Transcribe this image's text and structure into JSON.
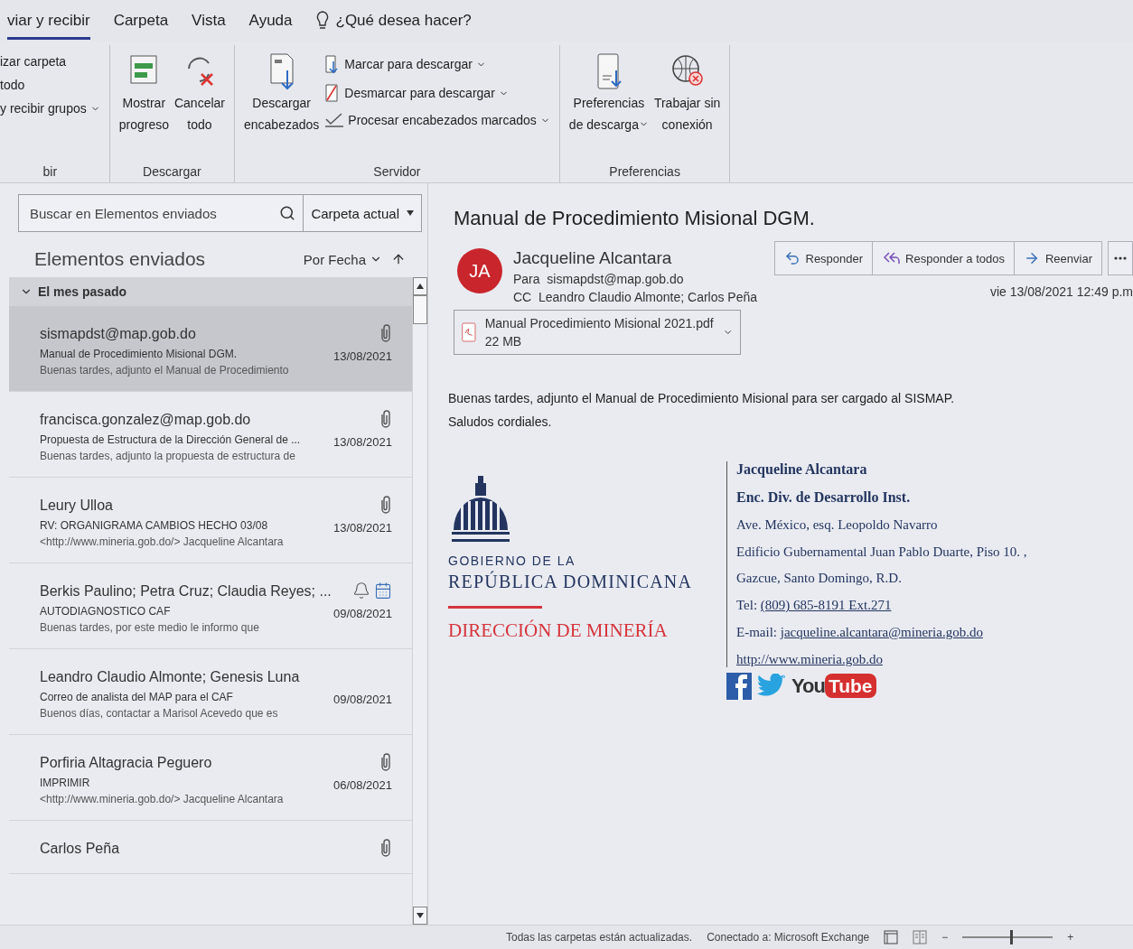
{
  "ribbon": {
    "tabs": [
      {
        "label": "viar y recibir",
        "selected": true
      },
      {
        "label": "Carpeta",
        "selected": false
      },
      {
        "label": "Vista",
        "selected": false
      },
      {
        "label": "Ayuda",
        "selected": false
      }
    ],
    "tell_me": "¿Qué desea hacer?",
    "groups": [
      {
        "label": "bir",
        "items": [
          {
            "kind": "small",
            "label": "izar carpeta",
            "dropdown": false
          },
          {
            "kind": "small",
            "label": "todo",
            "dropdown": false
          },
          {
            "kind": "small",
            "label": "y recibir grupos",
            "dropdown": true
          }
        ]
      },
      {
        "label": "Descargar",
        "items": [
          {
            "kind": "large",
            "lines": [
              "Mostrar",
              "progreso"
            ],
            "dropdown": false
          },
          {
            "kind": "large",
            "lines": [
              "Cancelar",
              "todo"
            ],
            "dropdown": false
          }
        ]
      },
      {
        "label": "Servidor",
        "items": [
          {
            "kind": "large",
            "lines": [
              "Descargar",
              "encabezados"
            ],
            "dropdown": false
          },
          {
            "kind": "small",
            "label": "Marcar para descargar",
            "dropdown": true
          },
          {
            "kind": "small",
            "label": "Desmarcar para descargar",
            "dropdown": true
          },
          {
            "kind": "small",
            "label": "Procesar encabezados marcados",
            "dropdown": true
          }
        ]
      },
      {
        "label": "Preferencias",
        "items": [
          {
            "kind": "large",
            "lines": [
              "Preferencias",
              "de descarga"
            ],
            "dropdown": true
          },
          {
            "kind": "large",
            "lines": [
              "Trabajar sin",
              "conexión"
            ],
            "dropdown": false
          }
        ]
      }
    ]
  },
  "mail_list": {
    "search": {
      "placeholder": "Buscar en Elementos enviados"
    },
    "scope": "Carpeta actual",
    "folder": "Elementos enviados",
    "sort": "Por Fecha",
    "group": "El mes pasado",
    "messages": [
      {
        "sender": "sismapdst@map.gob.do",
        "subject": "Manual de Procedimiento Misional DGM.",
        "preview": "Buenas tardes, adjunto el Manual de Procedimiento",
        "date": "13/08/2021",
        "kind": "attachment",
        "selected": true
      },
      {
        "sender": "francisca.gonzalez@map.gob.do",
        "subject": "Propuesta de Estructura de la Dirección General de ...",
        "preview": "Buenas tardes, adjunto la propuesta de estructura de",
        "date": "13/08/2021",
        "kind": "attachment",
        "selected": false
      },
      {
        "sender": "Leury Ulloa",
        "subject": "RV: ORGANIGRAMA CAMBIOS HECHO 03/08",
        "preview": "<http://www.mineria.gob.do/>  Jacqueline Alcantara",
        "date": "13/08/2021",
        "kind": "attachment",
        "selected": false
      },
      {
        "sender": "Berkis Paulino; Petra Cruz; Claudia Reyes; ...",
        "subject": "AUTODIAGNOSTICO CAF",
        "preview": "Buenas tardes, por este medio le informo que",
        "date": "09/08/2021",
        "kind": "meeting",
        "selected": false
      },
      {
        "sender": "Leandro Claudio Almonte; Genesis Luna",
        "subject": "Correo de analista del MAP para el CAF",
        "preview": "Buenos días,  contactar a Marisol Acevedo que es",
        "date": "09/08/2021",
        "kind": "plain",
        "selected": false
      },
      {
        "sender": "Porfiria Altagracia Peguero",
        "subject": "IMPRIMIR",
        "preview": "<http://www.mineria.gob.do/>  Jacqueline Alcantara",
        "date": "06/08/2021",
        "kind": "attachment",
        "selected": false
      },
      {
        "sender": "Carlos  Peña",
        "kind": "attachment",
        "selected": false
      }
    ]
  },
  "reading": {
    "title": "Manual de Procedimiento Misional DGM.",
    "initials": "JA",
    "from": "Jacqueline Alcantara",
    "to_label": "Para",
    "to": "sismapdst@map.gob.do",
    "cc_label": "CC",
    "cc": "Leandro Claudio Almonte; Carlos  Peña",
    "date": "vie 13/08/2021 12:49 p.m",
    "actions": [
      "Responder",
      "Responder a todos",
      "Reenviar"
    ],
    "attachment": {
      "name": "Manual Procedimiento Misional 2021.pdf",
      "size": "22 MB"
    },
    "body": [
      "Buenas tardes, adjunto el Manual de Procedimiento Misional para ser cargado al SISMAP.",
      "Saludos cordiales."
    ],
    "signature": {
      "logo": {
        "line1": "GOBIERNO DE LA",
        "line2": "REPÚBLICA DOMINICANA",
        "line3": "DIRECCIÓN DE MINERÍA"
      },
      "lines": [
        {
          "kind": "bold",
          "text": "Jacqueline Alcantara"
        },
        {
          "kind": "bold",
          "text": "Enc. Div. de Desarrollo   Inst."
        },
        {
          "kind": "plain",
          "text": "Ave. México, esq. Leopoldo Navarro"
        },
        {
          "kind": "plain",
          "text": "Edificio Gubernamental Juan Pablo Duarte, Piso 10. ,"
        },
        {
          "kind": "plain",
          "text": "Gazcue, Santo Domingo, R.D."
        },
        {
          "kind": "link",
          "label": "Tel:",
          "text": "(809) 685-8191 Ext.271"
        },
        {
          "kind": "link",
          "label": "E-mail:",
          "text": "jacqueline.alcantara@mineria.gob.do"
        },
        {
          "kind": "link",
          "text": "http://www.mineria.gob.do"
        }
      ],
      "youtube": {
        "left": "You",
        "right": "Tube"
      }
    }
  },
  "status_bar": {
    "items": [
      "Todas las carpetas están actualizadas.",
      "Conectado a: Microsoft Exchange"
    ],
    "zoom": {
      "minus": "−",
      "plus": "+",
      "level": 0.55
    }
  }
}
